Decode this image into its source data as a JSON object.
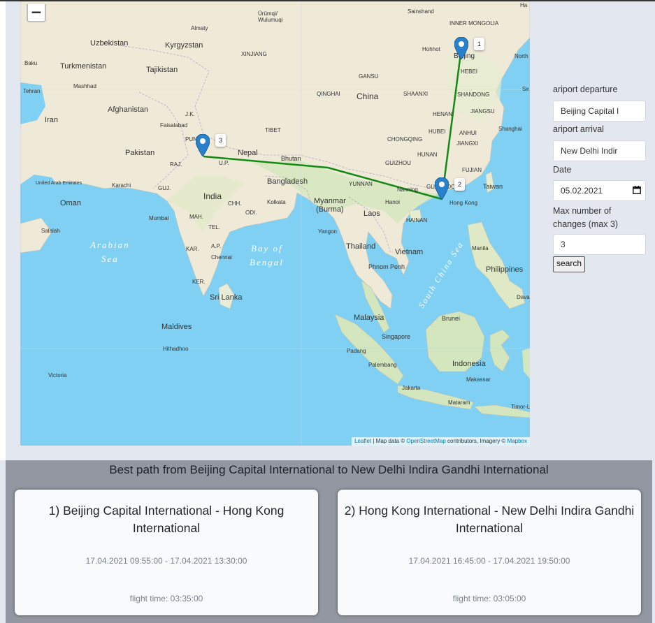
{
  "map": {
    "zoom_out_label": "−",
    "attribution": {
      "leaflet": "Leaflet",
      "sep": " | Map data © ",
      "osm": "OpenStreetMap",
      "mid": " contributors, Imagery © ",
      "mapbox": "Mapbox"
    },
    "route_color": "#138a13",
    "markers": [
      {
        "label": "1",
        "city": "Beijing"
      },
      {
        "label": "2",
        "city": "Hong Kong"
      },
      {
        "label": "3",
        "city": "New Delhi"
      }
    ],
    "place_labels": {
      "uzbekistan": "Uzbekistan",
      "kyrgyzstan": "Kyrgyzstan",
      "tajikistan": "Tajikistan",
      "turkmenistan": "Turkmenistan",
      "afghanistan": "Afghanistan",
      "iran": "Iran",
      "pakistan": "Pakistan",
      "india": "India",
      "nepal": "Nepal",
      "bhutan": "Bhutan",
      "bangladesh": "Bangladesh",
      "myanmar": "Myanmar",
      "burma": "(Burma)",
      "china": "China",
      "laos": "Laos",
      "thailand": "Thailand",
      "vietnam": "Vietnam",
      "cambodia": "Phnom Penh",
      "malaysia": "Malaysia",
      "singapore": "Singapore",
      "indonesia": "Indonesia",
      "brunei": "Brunei",
      "philippines": "Philippines",
      "taiwan": "Taiwan",
      "srilanka": "Sri Lanka",
      "maldives": "Maldives",
      "oman": "Oman",
      "uae": "United Arab Emirates",
      "inner_mongolia": "INNER MONGOLIA",
      "xinjiang": "XINJIANG",
      "tibet": "TIBET",
      "qinghai": "QINGHAI",
      "gansu": "GANSU",
      "shaanxi": "SHAANXI",
      "shandong": "SHANDONG",
      "henan": "HENAN",
      "jiangsu": "JIANGSU",
      "hubei": "HUBEI",
      "anhui": "ANHUI",
      "chongqing": "CHONGQING",
      "hunan": "HUNAN",
      "jiangxi": "JIANGXI",
      "guizhou": "GUIZHOU",
      "yunnan": "YUNNAN",
      "fujian": "FUJIAN",
      "guangdong": "GUANGDONG",
      "hebei": "HEBEI",
      "hainan": "HAINAN",
      "jk": "J.K.",
      "punjab": "PUNJAB",
      "raj": "RAJ.",
      "up": "U.P.",
      "guj": "GUJ.",
      "mah": "MAH.",
      "chh": "CHH.",
      "odi": "ODI.",
      "tel": "TEL.",
      "ap": "A.P.",
      "kar": "KAR.",
      "ap2": "A.P.",
      "ker": "KER.",
      "almaty": "Almaty",
      "urumqi": "Ürümqi/\nWulumuqi",
      "baku": "Baku",
      "tehran": "Tehran",
      "mashhad": "Mashhad",
      "faisalabad": "Faisalabad",
      "karachi": "Karachi",
      "mumbai": "Mumbai",
      "chennai": "Chennai",
      "kolkata": "Kolkata",
      "hanoi": "Hanoi",
      "nanning": "Nanning",
      "hongkong": "Hong Kong",
      "yangon": "Yangon",
      "manila": "Manila",
      "hohhot": "Hohhot",
      "beijing": "Beijing",
      "shanghai": "Shanghai",
      "sainshand": "Sainshand",
      "padang": "Padang",
      "palembang": "Palembang",
      "jakarta": "Jakarta",
      "mataram": "Mataram",
      "makassar": "Makassar",
      "victoria": "Victoria",
      "hithadhoo": "Hithadhoo",
      "salalah": "Salalah",
      "davao": "Davao",
      "timor": "Timor-L",
      "north": "North",
      "se": "Se",
      "ha": "Ha",
      "arabian": "Arabian",
      "sea": "Sea",
      "bay": "Bay of",
      "bengal": "Bengal",
      "scs": "South China Sea"
    }
  },
  "form": {
    "departure_label": "ariport departure",
    "departure_value": "Beijing Capital I",
    "arrival_label": "ariport arrival",
    "arrival_value": "New Delhi Indir",
    "date_label": "Date",
    "date_value": "05.02.2021",
    "changes_label": "Max number of changes (max 3)",
    "changes_value": "3",
    "search_label": "search"
  },
  "results": {
    "title": "Best path from Beijing Capital International to New Delhi Indira Gandhi International",
    "cards": [
      {
        "title": "1) Beijing Capital International - Hong Kong International",
        "times": "17.04.2021 09:55:00 - 17.04.2021 13:30:00",
        "duration": "flight time: 03:35:00"
      },
      {
        "title": "2) Hong Kong International - New Delhi Indira Gandhi International",
        "times": "17.04.2021 16:45:00 - 17.04.2021 19:50:00",
        "duration": "flight time: 03:05:00"
      }
    ]
  }
}
